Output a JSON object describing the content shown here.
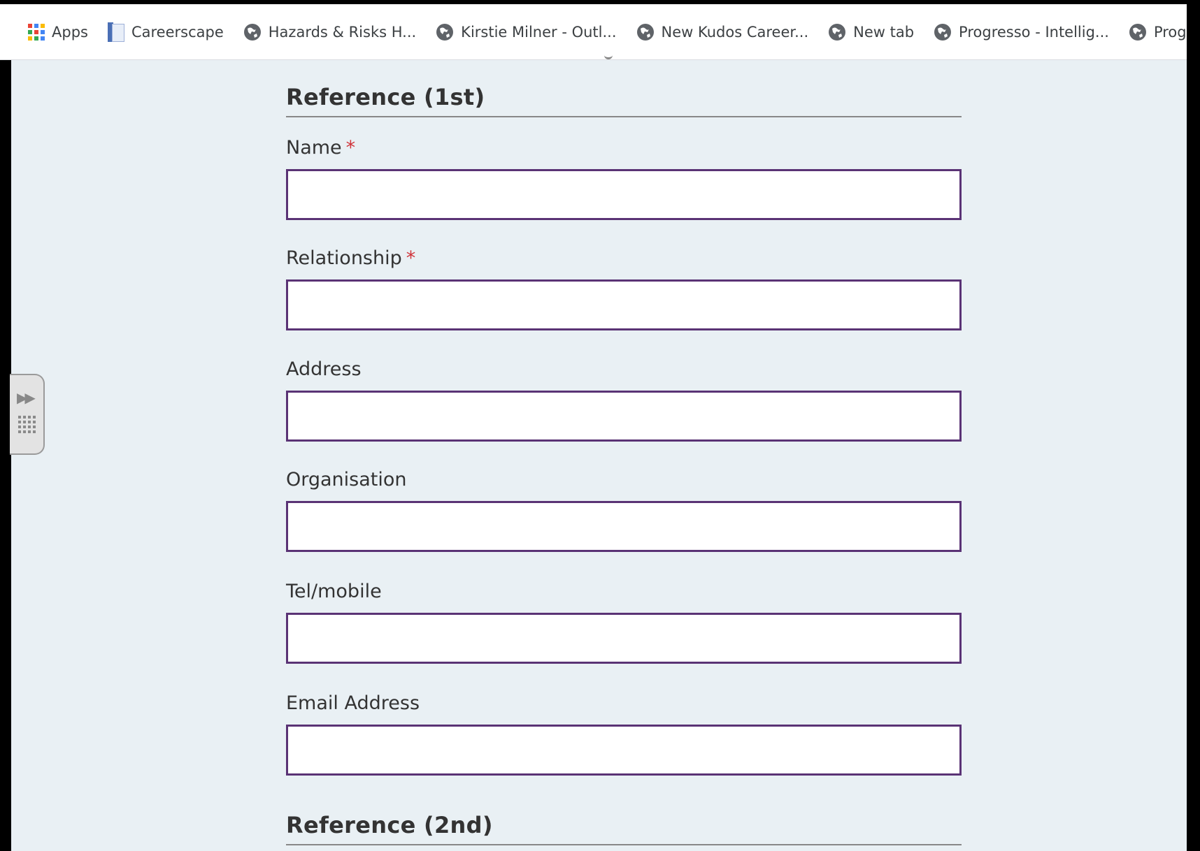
{
  "bookmarks": [
    {
      "label": "Apps",
      "icon": "apps-grid-icon"
    },
    {
      "label": "Careerscape",
      "icon": "document-icon"
    },
    {
      "label": "Hazards & Risks  H...",
      "icon": "globe-icon"
    },
    {
      "label": "Kirstie Milner - Outl...",
      "icon": "globe-icon"
    },
    {
      "label": "New Kudos Career...",
      "icon": "globe-icon"
    },
    {
      "label": "New tab",
      "icon": "globe-icon"
    },
    {
      "label": "Progresso - Intellig...",
      "icon": "globe-icon"
    },
    {
      "label": "Prog",
      "icon": "globe-icon"
    }
  ],
  "form": {
    "reference1_title": "Reference (1st)",
    "reference2_title": "Reference (2nd)",
    "required_marker": "*",
    "fields": [
      {
        "label": "Name",
        "required": true,
        "value": ""
      },
      {
        "label": "Relationship",
        "required": true,
        "value": ""
      },
      {
        "label": "Address",
        "required": false,
        "value": ""
      },
      {
        "label": "Organisation",
        "required": false,
        "value": ""
      },
      {
        "label": "Tel/mobile",
        "required": false,
        "value": ""
      },
      {
        "label": "Email Address",
        "required": false,
        "value": ""
      }
    ]
  },
  "colors": {
    "input_border": "#5a3375",
    "required": "#d0343a",
    "background": "#e9f0f4"
  }
}
